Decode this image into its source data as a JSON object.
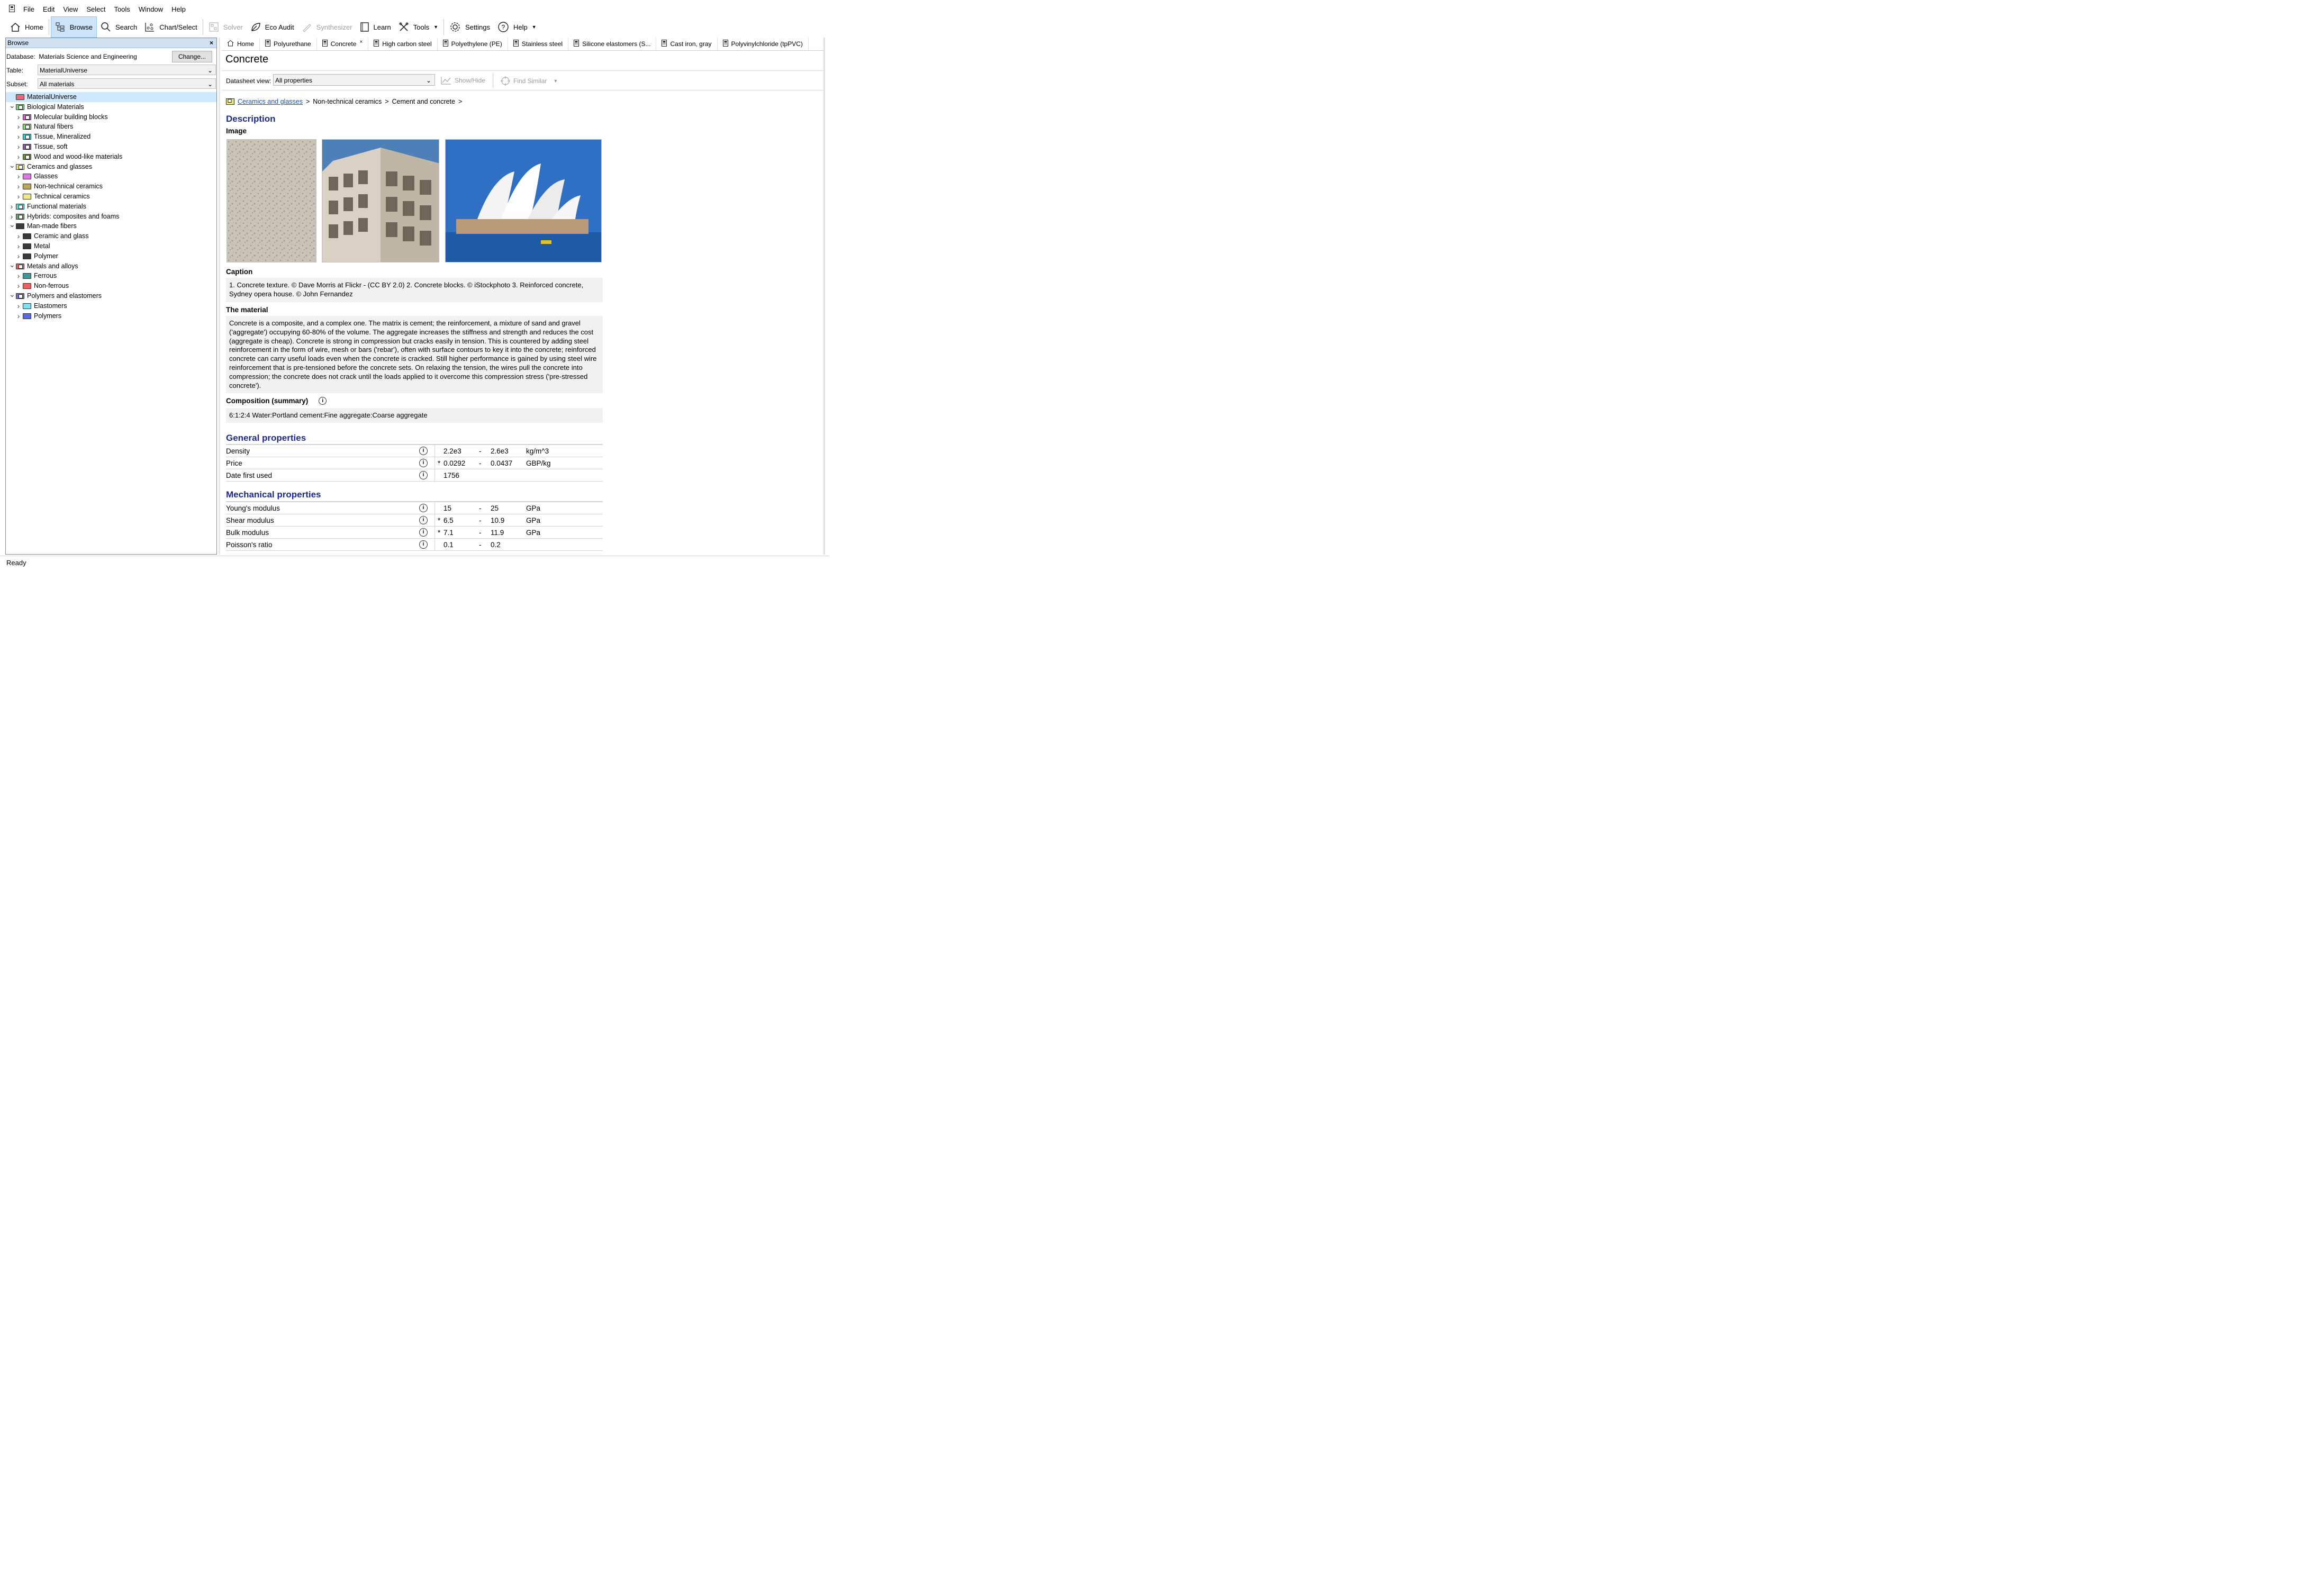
{
  "menu": {
    "items": [
      "File",
      "Edit",
      "View",
      "Select",
      "Tools",
      "Window",
      "Help"
    ]
  },
  "toolbar": {
    "home": "Home",
    "browse": "Browse",
    "search": "Search",
    "chart_select": "Chart/Select",
    "solver": "Solver",
    "eco_audit": "Eco Audit",
    "synthesizer": "Synthesizer",
    "learn": "Learn",
    "tools": "Tools",
    "settings": "Settings",
    "help": "Help"
  },
  "browse": {
    "title": "Browse",
    "close": "×",
    "database_label": "Database:",
    "database_value": "Materials Science and Engineering",
    "change_button": "Change...",
    "table_label": "Table:",
    "table_value": "MaterialUniverse",
    "subset_label": "Subset:",
    "subset_value": "All materials",
    "tree": [
      {
        "label": "MaterialUniverse",
        "depth": 0,
        "exp": "",
        "color": "#e26b7b",
        "plain": true,
        "selected": true
      },
      {
        "label": "Biological Materials",
        "depth": 0,
        "exp": "v",
        "color": "#7fd27a"
      },
      {
        "label": "Molecular building blocks",
        "depth": 1,
        "exp": ">",
        "color": "#d658d0"
      },
      {
        "label": "Natural fibers",
        "depth": 1,
        "exp": ">",
        "color": "#7ddc6a"
      },
      {
        "label": "Tissue, Mineralized",
        "depth": 1,
        "exp": ">",
        "color": "#3fc6c6"
      },
      {
        "label": "Tissue, soft",
        "depth": 1,
        "exp": ">",
        "color": "#8c5aa8"
      },
      {
        "label": "Wood and wood-like materials",
        "depth": 1,
        "exp": ">",
        "color": "#6e8a3c"
      },
      {
        "label": "Ceramics and glasses",
        "depth": 0,
        "exp": "v",
        "color": "#ece36a"
      },
      {
        "label": "Glasses",
        "depth": 1,
        "exp": ">",
        "color": "#e873e8",
        "plain": true
      },
      {
        "label": "Non-technical ceramics",
        "depth": 1,
        "exp": ">",
        "color": "#b8a85a",
        "plain": true
      },
      {
        "label": "Technical ceramics",
        "depth": 1,
        "exp": ">",
        "color": "#f1ea7e",
        "plain": true
      },
      {
        "label": "Functional materials",
        "depth": 0,
        "exp": ">",
        "color": "#5fd3d3"
      },
      {
        "label": "Hybrids: composites and foams",
        "depth": 0,
        "exp": ">",
        "color": "#5fa86a"
      },
      {
        "label": "Man-made fibers",
        "depth": 0,
        "exp": "v",
        "color": "#3a3a3a",
        "plain": true
      },
      {
        "label": "Ceramic and glass",
        "depth": 1,
        "exp": ">",
        "color": "#3a3a3a",
        "plain": true
      },
      {
        "label": "Metal",
        "depth": 1,
        "exp": ">",
        "color": "#3a3a3a",
        "plain": true
      },
      {
        "label": "Polymer",
        "depth": 1,
        "exp": ">",
        "color": "#3a3a3a",
        "plain": true
      },
      {
        "label": "Metals and alloys",
        "depth": 0,
        "exp": "v",
        "color": "#e55a5a"
      },
      {
        "label": "Ferrous",
        "depth": 1,
        "exp": ">",
        "color": "#3a9a9a",
        "plain": true
      },
      {
        "label": "Non-ferrous",
        "depth": 1,
        "exp": ">",
        "color": "#f06060",
        "plain": true
      },
      {
        "label": "Polymers and elastomers",
        "depth": 0,
        "exp": "v",
        "color": "#6a6ae0"
      },
      {
        "label": "Elastomers",
        "depth": 1,
        "exp": ">",
        "color": "#7fe0f0",
        "plain": true
      },
      {
        "label": "Polymers",
        "depth": 1,
        "exp": ">",
        "color": "#5a6ae6",
        "plain": true
      }
    ]
  },
  "tabs": [
    "Home",
    "Polyurethane",
    "Concrete",
    "High carbon steel",
    "Polyethylene (PE)",
    "Stainless steel",
    "Silicone elastomers (S...",
    "Cast iron, gray",
    "Polyvinylchloride (tpPVC)"
  ],
  "tab_close": "×",
  "page": {
    "title": "Concrete",
    "datasheet_label": "Datasheet view:",
    "datasheet_value": "All properties",
    "show_hide": "Show/Hide",
    "find_similar": "Find Similar",
    "breadcrumb": [
      "Ceramics and glasses",
      "Non-technical ceramics",
      "Cement and concrete"
    ],
    "crumb_sep": ">",
    "description_heading": "Description",
    "image_label": "Image",
    "caption_label": "Caption",
    "caption_text": "1. Concrete texture. © Dave Morris at Flickr - (CC BY 2.0) 2. Concrete blocks. © iStockphoto 3. Reinforced concrete, Sydney opera house. © John Fernandez",
    "material_label": "The material",
    "material_text": "Concrete is a composite, and a complex one. The matrix is cement; the reinforcement, a mixture of sand and gravel ('aggregate') occupying 60-80% of the volume. The aggregate increases the stiffness and strength and reduces the cost (aggregate is cheap). Concrete is strong in compression but cracks easily in tension. This is countered by adding steel reinforcement in the form of wire, mesh or bars ('rebar'), often with surface contours to key it into the concrete; reinforced concrete can carry useful loads even when the concrete is cracked. Still higher performance is gained by using steel wire reinforcement that is pre-tensioned before the concrete sets. On relaxing the tension, the wires pull the concrete into compression; the concrete does not crack until the loads applied to it overcome this compression stress ('pre-stressed concrete').",
    "composition_label": "Composition (summary)",
    "composition_text": "6:1:2:4 Water:Portland cement:Fine aggregate:Coarse aggregate",
    "general_heading": "General properties",
    "general": [
      {
        "name": "Density",
        "star": "",
        "v1": "2.2e3",
        "dash": "-",
        "v2": "2.6e3",
        "unit": "kg/m^3"
      },
      {
        "name": "Price",
        "star": "*",
        "v1": "0.0292",
        "dash": "-",
        "v2": "0.0437",
        "unit": "GBP/kg"
      },
      {
        "name": "Date first used",
        "star": "",
        "v1": "1756",
        "dash": "",
        "v2": "",
        "unit": ""
      }
    ],
    "mechanical_heading": "Mechanical properties",
    "mechanical": [
      {
        "name": "Young's modulus",
        "star": "",
        "v1": "15",
        "dash": "-",
        "v2": "25",
        "unit": "GPa"
      },
      {
        "name": "Shear modulus",
        "star": "*",
        "v1": "6.5",
        "dash": "-",
        "v2": "10.9",
        "unit": "GPa"
      },
      {
        "name": "Bulk modulus",
        "star": "*",
        "v1": "7.1",
        "dash": "-",
        "v2": "11.9",
        "unit": "GPa"
      },
      {
        "name": "Poisson's ratio",
        "star": "",
        "v1": "0.1",
        "dash": "-",
        "v2": "0.2",
        "unit": ""
      }
    ]
  },
  "status": "Ready"
}
